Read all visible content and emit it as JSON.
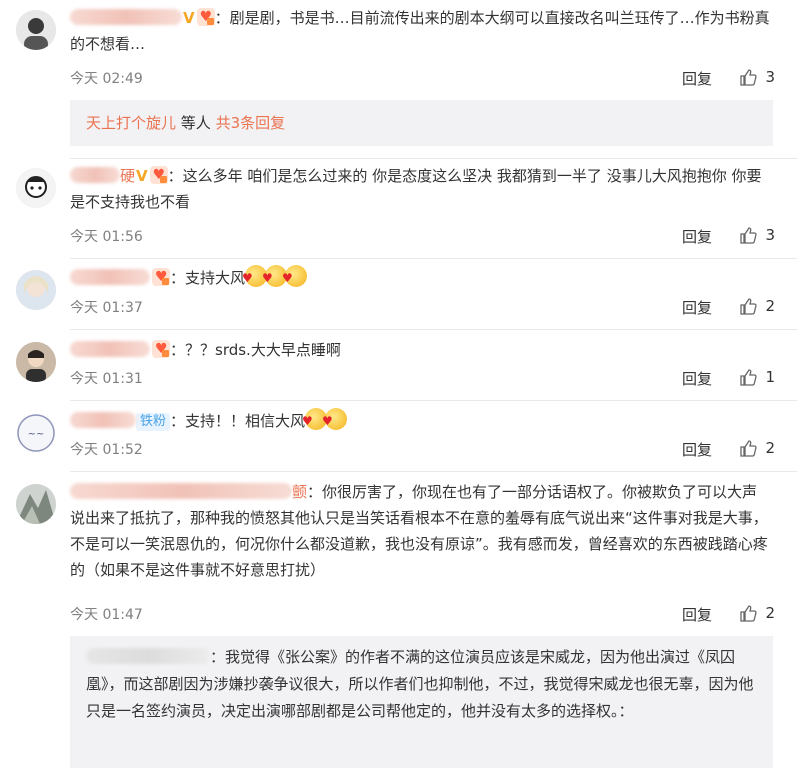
{
  "comments": [
    {
      "text": "：剧是剧，书是书…目前流传出来的剧本大纲可以直接改名叫兰珏传了…作为书粉真的不想看…",
      "time": "今天 02:49",
      "reply_label": "回复",
      "likes": "3",
      "reply_summary": {
        "user": "天上打个旋儿",
        "mid": " 等人 ",
        "count": "共3条回复"
      }
    },
    {
      "name_tail": "硬",
      "text": "：这么多年  咱们是怎么过来的 你是态度这么坚决 我都猜到一半了  没事儿大风抱抱你 你要是不支持我也不看",
      "time": "今天 01:56",
      "reply_label": "回复",
      "likes": "3"
    },
    {
      "text": "：支持大风",
      "time": "今天 01:37",
      "reply_label": "回复",
      "likes": "2"
    },
    {
      "text": "：？？srds.大大早点睡啊",
      "time": "今天 01:31",
      "reply_label": "回复",
      "likes": "1"
    },
    {
      "badge": "铁粉",
      "text": "：支持！！相信大风",
      "time": "今天 01:52",
      "reply_label": "回复",
      "likes": "2"
    },
    {
      "name_tail": "颤",
      "text": "：你很厉害了，你现在也有了一部分话语权了。你被欺负了可以大声说出来了抵抗了，那种我的愤怒其他认只是当笑话看根本不在意的羞辱有底气说出来“这件事对我是大事，不是可以一笑泯恩仇的，何况你什么都没道歉，我也没有原谅”。我有感而发，曾经喜欢的东西被践踏心疼的（如果不是这件事就不好意思打扰）",
      "time": "今天 01:47",
      "reply_label": "回复",
      "likes": "2"
    }
  ],
  "sub_reply": {
    "text": "：我觉得《张公案》的作者不满的这位演员应该是宋威龙，因为他出演过《凤囚凰》，而这部剧因为涉嫌抄袭争议很大，所以作者们也抑制他，不过，我觉得宋威龙也很无辜，因为他只是一名签约演员，决定出演哪部剧都是公司帮他定的，他并没有太多的选择权。："
  },
  "icons": {
    "like": "thumbs-up-icon",
    "vip": "v-badge-icon",
    "fan": "fan-badge-icon",
    "emoji": "hug-emoji-icon"
  },
  "colors": {
    "username": "#eb7350",
    "link": "#eb7350",
    "meta": "#808080",
    "reply_bg": "#f2f2f5"
  }
}
